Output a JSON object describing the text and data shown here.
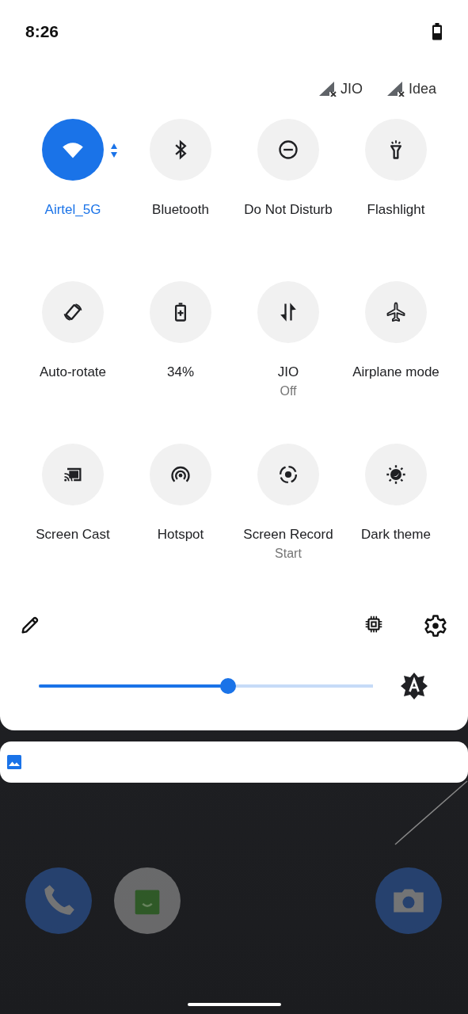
{
  "status_bar": {
    "time": "8:26"
  },
  "sim_cards": [
    {
      "name": "JIO"
    },
    {
      "name": "Idea"
    }
  ],
  "tiles": [
    {
      "label": "Airtel_5G",
      "on": true,
      "dropdown": true
    },
    {
      "label": "Bluetooth",
      "on": false
    },
    {
      "label": "Do Not Disturb",
      "on": false
    },
    {
      "label": "Flashlight",
      "on": false
    },
    {
      "label": "Auto-rotate",
      "on": false
    },
    {
      "label": "34%",
      "on": false
    },
    {
      "label": "JIO",
      "secondary": "Off",
      "on": false
    },
    {
      "label": "Airplane mode",
      "on": false
    },
    {
      "label": "Screen Cast",
      "on": false
    },
    {
      "label": "Hotspot",
      "on": false
    },
    {
      "label": "Screen Record",
      "secondary": "Start",
      "on": false
    },
    {
      "label": "Dark theme",
      "on": false
    }
  ],
  "brightness": {
    "level": 0.567,
    "auto": true
  }
}
